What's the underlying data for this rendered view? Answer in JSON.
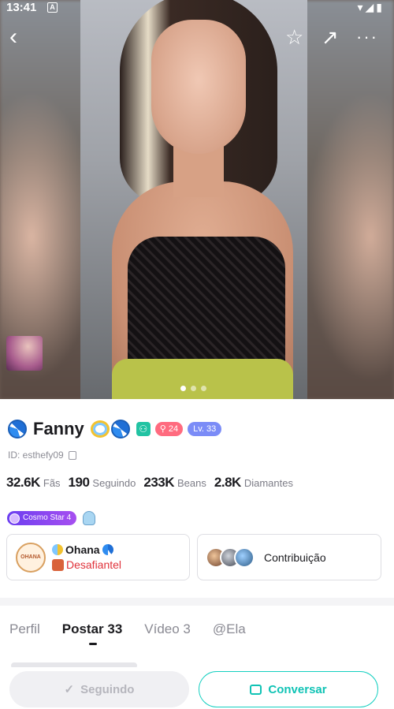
{
  "status_bar": {
    "time": "13:41",
    "indicator": "A",
    "icons": "wifi, signal, battery"
  },
  "header": {
    "back_icon": "chevron-left-icon",
    "favorite_icon": "star-plus-icon",
    "share_icon": "share-icon",
    "more_icon": "more-horizontal-icon"
  },
  "photo": {
    "slides_total": 3,
    "active_slide": 1
  },
  "profile": {
    "name": "Fanny",
    "level_badge": "24",
    "lv_badge": "Lv. 33",
    "id_text": "ID: esthefy09",
    "stats": [
      {
        "value": "32.6K",
        "label": "Fãs"
      },
      {
        "value": "190",
        "label": "Seguindo"
      },
      {
        "value": "233K",
        "label": "Beans"
      },
      {
        "value": "2.8K",
        "label": "Diamantes"
      }
    ],
    "cosmo_badge": "Cosmo Star 4"
  },
  "family_card": {
    "logo_text": "OHANA",
    "name": "Ohana",
    "rank": "Desafiantel"
  },
  "contribution_card": {
    "label": "Contribuição"
  },
  "tabs": [
    {
      "label": "Perfil"
    },
    {
      "label": "Postar 33"
    },
    {
      "label": "Vídeo 3"
    },
    {
      "label": "@Ela"
    }
  ],
  "active_tab": "Postar 33",
  "actions": {
    "following_label": "Seguindo",
    "chat_label": "Conversar"
  },
  "colors": {
    "accent": "#10c3b5",
    "challenge_red": "#e0323a",
    "lv_badge": "#7b8cf7",
    "level_badge": "#ff6b7f"
  }
}
